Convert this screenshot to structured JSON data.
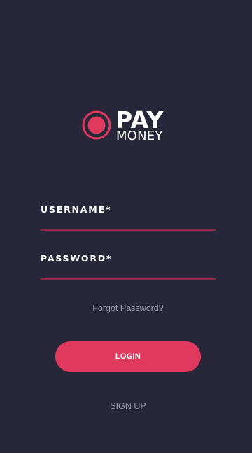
{
  "logo": {
    "line1": "PAY",
    "line2": "MONEY"
  },
  "form": {
    "username_label": "USERNAME*",
    "password_label": "PASSWORD*",
    "username_value": "",
    "password_value": ""
  },
  "links": {
    "forgot_password": "Forgot Password?",
    "sign_up": "SIGN UP"
  },
  "buttons": {
    "login": "LOGIN"
  },
  "colors": {
    "background": "#272739",
    "accent": "#df3a5e",
    "underline": "#8a2a4b",
    "muted_text": "#9b9bab"
  }
}
